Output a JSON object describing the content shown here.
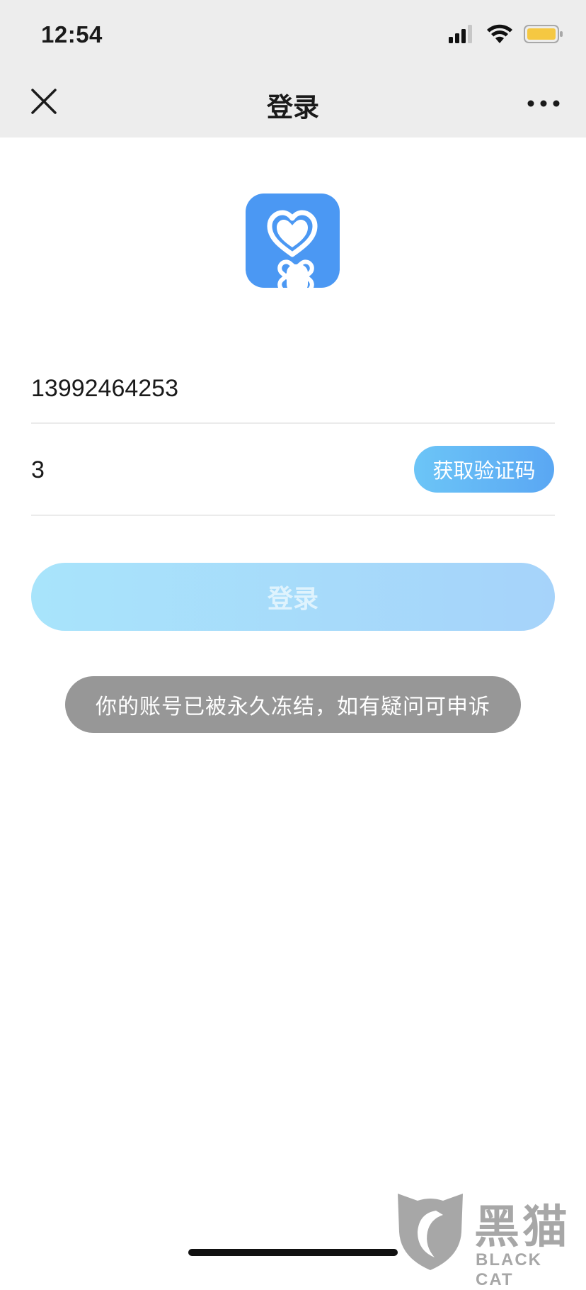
{
  "status_bar": {
    "time": "12:54",
    "icons": [
      "cellular-signal-icon",
      "wifi-icon",
      "battery-icon"
    ],
    "battery_color": "#f5c842"
  },
  "nav": {
    "title": "登录",
    "close_icon": "close-icon",
    "more_icon": "more-icon"
  },
  "app": {
    "logo_icon": "heart-finger-logo-icon",
    "logo_color": "#4b98f3"
  },
  "form": {
    "phone_value": "13992464253",
    "code_value": "3",
    "get_code_label": "获取验证码",
    "login_label": "登录"
  },
  "toast": {
    "message": "你的账号已被永久冻结，如有疑问可申诉"
  },
  "watermark": {
    "cn": "黑猫",
    "en": "BLACK CAT"
  },
  "colors": {
    "accent": "#5aa7f3",
    "login_gradient_start": "#a8e4fb",
    "login_gradient_end": "#a6d3fa",
    "toast_bg": "#979797"
  }
}
